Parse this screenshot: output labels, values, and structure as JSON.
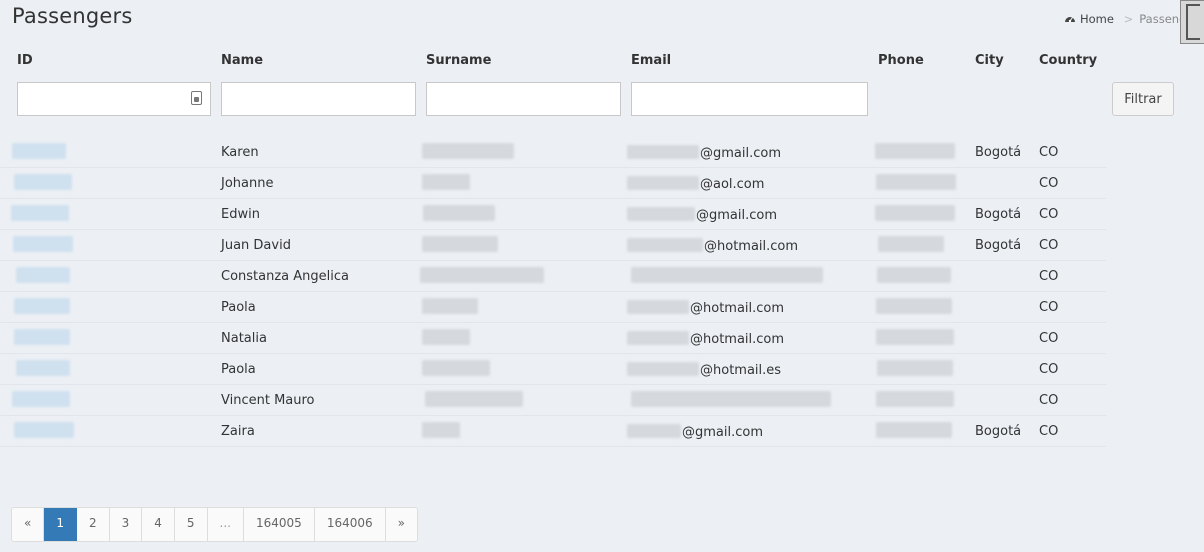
{
  "page": {
    "title": "Passengers"
  },
  "breadcrumb": {
    "home": "Home",
    "current": "Passengers"
  },
  "columns": {
    "id": "ID",
    "name": "Name",
    "surname": "Surname",
    "email": "Email",
    "phone": "Phone",
    "city": "City",
    "country": "Country"
  },
  "filters": {
    "button_label": "Filtrar"
  },
  "rows": [
    {
      "name": "Karen",
      "email_domain": "@gmail.com",
      "city": "Bogotá",
      "country": "CO"
    },
    {
      "name": "Johanne",
      "email_domain": "@aol.com",
      "city": "",
      "country": "CO"
    },
    {
      "name": "Edwin",
      "email_domain": "@gmail.com",
      "city": "Bogotá",
      "country": "CO"
    },
    {
      "name": "Juan David",
      "email_domain": "@hotmail.com",
      "city": "Bogotá",
      "country": "CO"
    },
    {
      "name": "Constanza Angelica",
      "email_domain": "",
      "city": "",
      "country": "CO"
    },
    {
      "name": "Paola",
      "email_domain": "@hotmail.com",
      "city": "",
      "country": "CO"
    },
    {
      "name": "Natalia",
      "email_domain": "@hotmail.com",
      "city": "",
      "country": "CO"
    },
    {
      "name": "Paola",
      "email_domain": "@hotmail.es",
      "city": "",
      "country": "CO"
    },
    {
      "name": "Vincent Mauro",
      "email_domain": "",
      "city": "",
      "country": "CO"
    },
    {
      "name": "Zaira",
      "email_domain": "@gmail.com",
      "city": "Bogotá",
      "country": "CO"
    }
  ],
  "pagination": {
    "prev": "«",
    "pages": [
      "1",
      "2",
      "3",
      "4",
      "5"
    ],
    "ellipsis": "...",
    "last_pages": [
      "164005",
      "164006"
    ],
    "next": "»",
    "active": "1"
  },
  "colors": {
    "background": "#ecf0f5",
    "active_page": "#337ab7",
    "redacted_id": "#cfe0ee",
    "redacted": "#d5d8dd"
  }
}
